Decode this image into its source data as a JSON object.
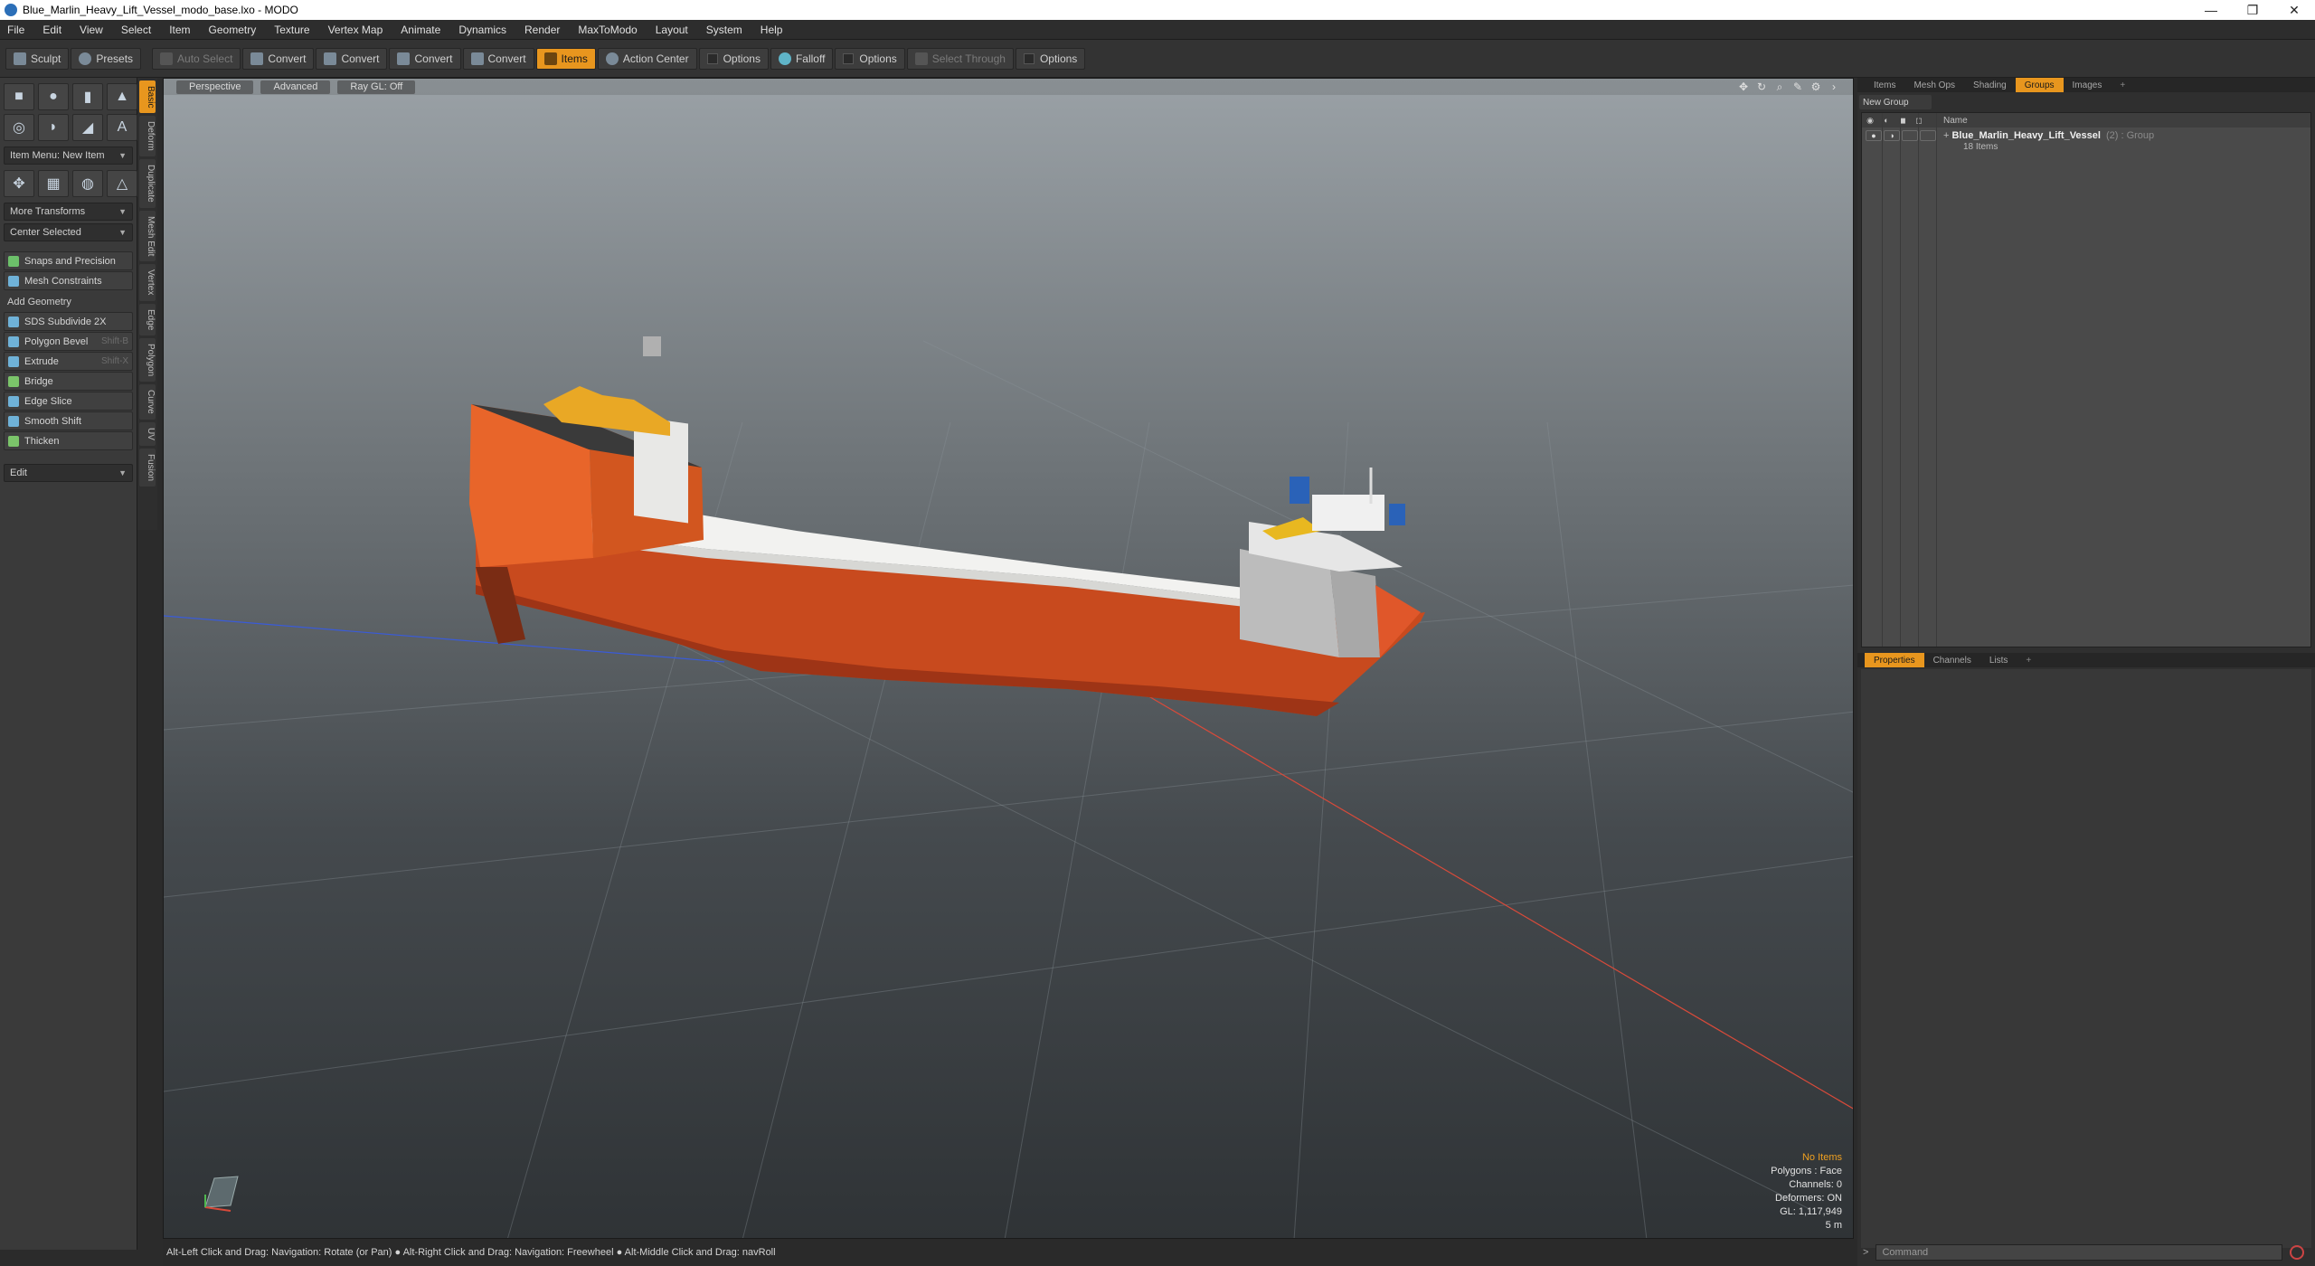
{
  "window": {
    "title": "Blue_Marlin_Heavy_Lift_Vessel_modo_base.lxo - MODO",
    "minimize": "—",
    "maximize": "❐",
    "close": "✕"
  },
  "menu": [
    "File",
    "Edit",
    "View",
    "Select",
    "Item",
    "Geometry",
    "Texture",
    "Vertex Map",
    "Animate",
    "Dynamics",
    "Render",
    "MaxToModo",
    "Layout",
    "System",
    "Help"
  ],
  "toolbar": {
    "sculpt": "Sculpt",
    "presets": "Presets",
    "auto_select": "Auto Select",
    "convert1": "Convert",
    "convert2": "Convert",
    "convert3": "Convert",
    "convert4": "Convert",
    "items": "Items",
    "action_center": "Action Center",
    "options1": "Options",
    "falloff": "Falloff",
    "options2": "Options",
    "select_through": "Select Through",
    "options3": "Options"
  },
  "left": {
    "item_menu": "Item Menu: New Item",
    "more_transforms": "More Transforms",
    "center_selected": "Center Selected",
    "snaps": "Snaps and Precision",
    "mesh_constraints": "Mesh Constraints",
    "add_geometry": "Add Geometry",
    "tools": [
      {
        "label": "SDS Subdivide 2X",
        "shortcut": ""
      },
      {
        "label": "Polygon Bevel",
        "shortcut": "Shift-B"
      },
      {
        "label": "Extrude",
        "shortcut": "Shift-X"
      },
      {
        "label": "Bridge",
        "shortcut": ""
      },
      {
        "label": "Edge Slice",
        "shortcut": ""
      },
      {
        "label": "Smooth Shift",
        "shortcut": ""
      },
      {
        "label": "Thicken",
        "shortcut": ""
      }
    ],
    "edit": "Edit",
    "vtabs": [
      "Basic",
      "Deform",
      "Duplicate",
      "Mesh Edit",
      "Vertex",
      "Edge",
      "Polygon",
      "Curve",
      "UV",
      "Fusion"
    ]
  },
  "viewport": {
    "perspective": "Perspective",
    "advanced": "Advanced",
    "raygl": "Ray GL: Off",
    "info": {
      "no_items": "No Items",
      "polygons": "Polygons : Face",
      "channels": "Channels: 0",
      "deformers": "Deformers: ON",
      "gl": "GL: 1,117,949",
      "scale": "5 m"
    }
  },
  "right": {
    "tabs": [
      "Items",
      "Mesh Ops",
      "Shading",
      "Groups",
      "Images",
      "+"
    ],
    "new_group": "New Group",
    "col_name": "Name",
    "group": {
      "name": "Blue_Marlin_Heavy_Lift_Vessel",
      "meta": "(2) : Group",
      "sub": "18 Items"
    },
    "prop_tabs": [
      "Properties",
      "Channels",
      "Lists",
      "+"
    ]
  },
  "status": {
    "text": "Alt-Left Click and Drag: Navigation: Rotate (or Pan) ● Alt-Right Click and Drag: Navigation: Freewheel ● Alt-Middle Click and Drag: navRoll"
  },
  "command": {
    "prompt": ">",
    "placeholder": "Command"
  }
}
